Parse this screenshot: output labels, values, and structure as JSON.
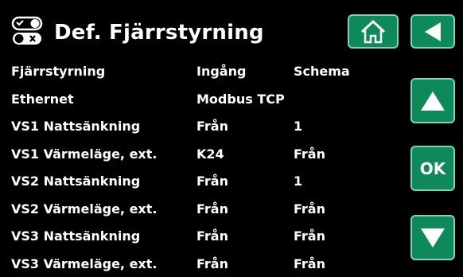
{
  "header": {
    "title": "Def. Fjärrstyrning",
    "icon": "remote-control-toggle-icon",
    "home_icon": "home-icon",
    "back_icon": "back-arrow-icon"
  },
  "sidebar": {
    "up_icon": "up-arrow-icon",
    "ok_label": "OK",
    "down_icon": "down-arrow-icon"
  },
  "rows": [
    {
      "name": "Fjärrstyrning",
      "col2": "Ingång",
      "col3": "Schema"
    },
    {
      "name": "Ethernet",
      "col2": "Modbus TCP",
      "col3": ""
    },
    {
      "name": "VS1 Nattsänkning",
      "col2": "Från",
      "col3": "1"
    },
    {
      "name": "VS1 Värmeläge, ext.",
      "col2": "K24",
      "col3": "Från"
    },
    {
      "name": "VS2 Nattsänkning",
      "col2": "Från",
      "col3": "1"
    },
    {
      "name": "VS2 Värmeläge, ext.",
      "col2": "Från",
      "col3": "Från"
    },
    {
      "name": "VS3 Nattsänkning",
      "col2": "Från",
      "col3": "Från"
    },
    {
      "name": "VS3 Värmeläge, ext.",
      "col2": "Från",
      "col3": "Från"
    }
  ],
  "colors": {
    "button_bg": "#0e8a5a",
    "button_border": "#7fd3b0",
    "background": "#000000",
    "text": "#ffffff"
  }
}
